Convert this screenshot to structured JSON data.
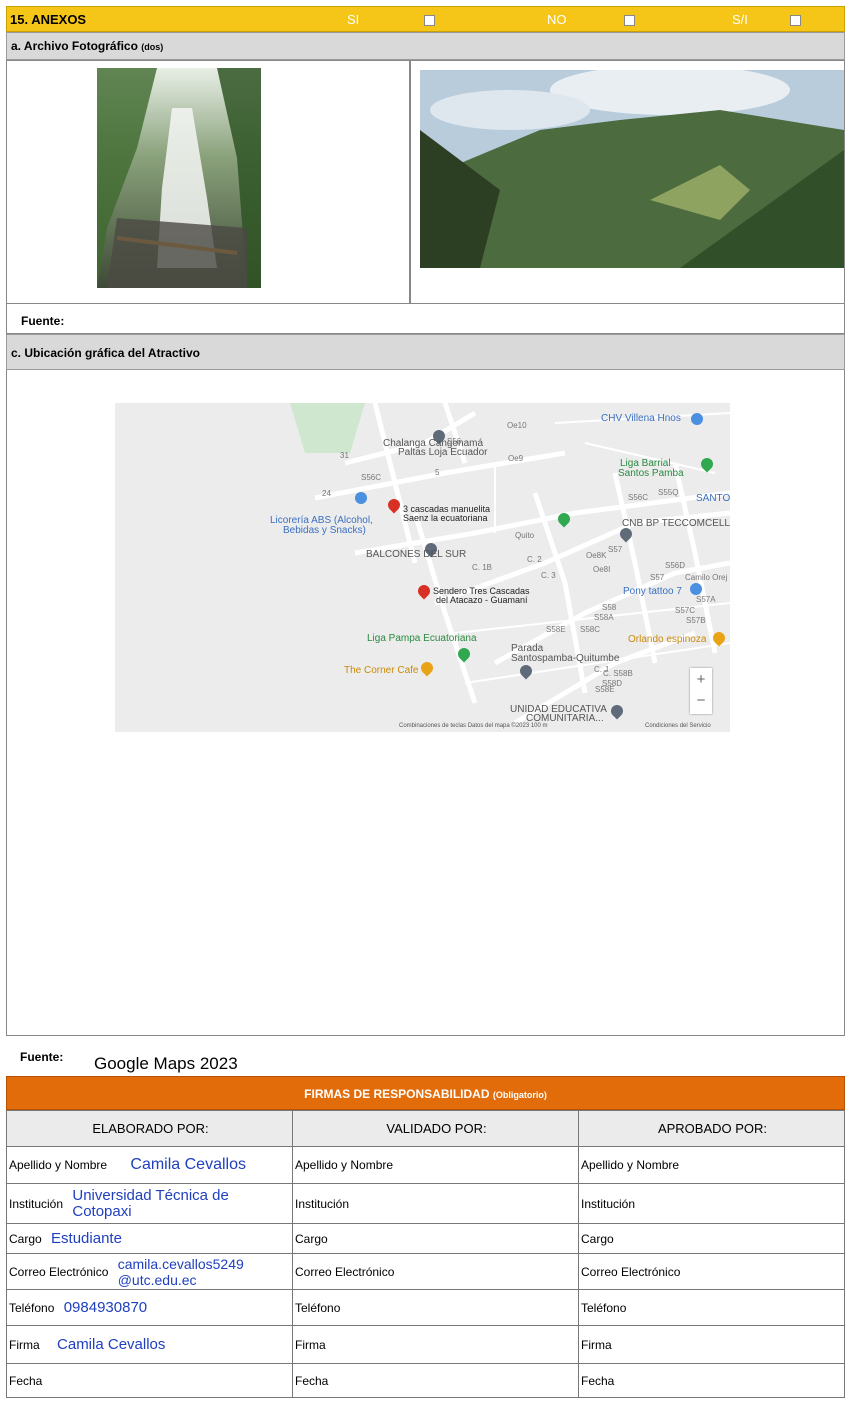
{
  "header": {
    "title": "15. ANEXOS",
    "si": "SI",
    "no": "NO",
    "sn": "S/I"
  },
  "archivo": {
    "title": "a. Archivo Fotográfico",
    "suffix": "(dos)"
  },
  "fuente1": {
    "label": "Fuente:",
    "value": ""
  },
  "ubicacion": {
    "title": "c. Ubicación gráfica del Atractivo"
  },
  "map": {
    "labels": [
      "Chalanga Cangonamá",
      "Paltas Loja Ecuador",
      "CHV Villena Hnos",
      "Liga Barrial",
      "Santos Pamba",
      "SANTOS",
      "3 cascadas manuelita",
      "Saenz la ecuatoriana",
      "Licorería ABS (Alcohol,",
      "Bebidas y Snacks)",
      "CNB BP TECCOMCELL",
      "BALCONES DEL SUR",
      "Pony tattoo 7",
      "Sendero Tres Cascadas",
      "del Atacazo - Guamaní",
      "Liga Pampa Ecuatoriana",
      "Orlando espinoza",
      "Parada",
      "Santospamba-Quitumbe",
      "The Corner Cafe",
      "UNIDAD EDUCATIVA",
      "COMUNITARIA..."
    ],
    "streets": [
      "S56",
      "Oe9",
      "Oe10",
      "S56C",
      "31",
      "24",
      "Quito",
      "C. 1B",
      "C. 2",
      "C. 3",
      "S56C",
      "S55Q",
      "Oe8K",
      "Oe8I",
      "S57",
      "S56D",
      "S57",
      "S58",
      "S58A",
      "S58C",
      "S57C",
      "S57A",
      "S57B",
      "S58E",
      "S58E",
      "C. S58B",
      "S58D",
      "C. J",
      "Camilo Orej",
      "5"
    ],
    "footer": "Combinaciones de teclas   Datos del mapa ©2023   100 m",
    "terms": "Condiciones del Servicio",
    "zoom_in": "+",
    "zoom_out": "−"
  },
  "fuente2": {
    "label": "Fuente:",
    "value": "Google Maps 2023"
  },
  "firmas": {
    "title": "FIRMAS DE RESPONSABILIDAD",
    "note": "(Obligatorio)"
  },
  "columns": [
    "ELABORADO POR:",
    "VALIDADO POR:",
    "APROBADO POR:"
  ],
  "rows": [
    {
      "label": "Apellido y Nombre",
      "value": "Camila Cevallos"
    },
    {
      "label": "Institución",
      "value": "Universidad Técnica de Cotopaxi"
    },
    {
      "label": "Cargo",
      "value": "Estudiante"
    },
    {
      "label": "Correo Electrónico",
      "value": "camila.cevallos5249 @utc.edu.ec"
    },
    {
      "label": "Teléfono",
      "value": "0984930870"
    },
    {
      "label": "Firma",
      "value": "Camila Cevallos"
    },
    {
      "label": "Fecha",
      "value": ""
    }
  ]
}
